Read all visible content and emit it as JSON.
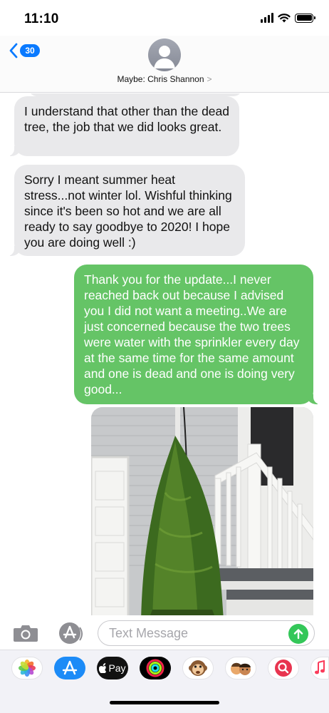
{
  "status_bar": {
    "time": "11:10"
  },
  "header": {
    "back_count": "30",
    "contact_name": "Maybe: Chris Shannon",
    "contact_chevron": ">"
  },
  "messages": [
    {
      "direction": "incoming",
      "text": "I understand that other than the dead tree, the job that we did looks great."
    },
    {
      "direction": "incoming",
      "text": "Sorry I meant summer heat stress...not winter lol. Wishful thinking since it's been so hot and we are all ready to say goodbye to 2020! I hope you are doing well :)"
    },
    {
      "direction": "outgoing",
      "text": "Thank you for the update...I never reached back out because I advised you I did not want a meeting..We are just concerned because the two trees were water with the sprinkler every day at the same time for the same amount and one is dead and one is doing very good..."
    }
  ],
  "input": {
    "placeholder": "Text Message",
    "value": ""
  },
  "app_drawer": {
    "apple_pay_label": "Pay",
    "apps": [
      "photos",
      "app-store",
      "apple-pay",
      "fitness-activity",
      "animoji-monkey",
      "memoji",
      "web-search",
      "music"
    ]
  },
  "colors": {
    "accent_blue": "#0a7aff",
    "outgoing_bubble": "#65c466",
    "incoming_bubble": "#e9e9eb",
    "send_button": "#34c759"
  }
}
